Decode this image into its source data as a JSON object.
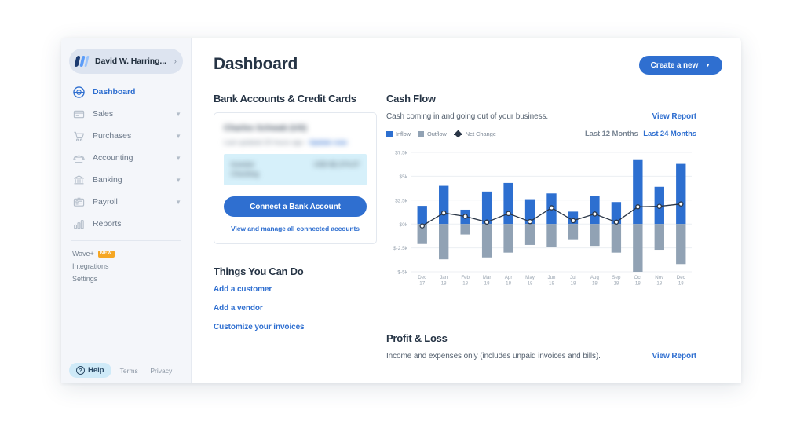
{
  "sidebar": {
    "profile": {
      "name": "David W. Harring...",
      "logo_icon": "wave-logo",
      "chevron_icon": "chevron-right-icon"
    },
    "items": [
      {
        "label": "Dashboard",
        "icon": "dashboard-icon",
        "active": true,
        "expandable": false
      },
      {
        "label": "Sales",
        "icon": "card-icon",
        "active": false,
        "expandable": true
      },
      {
        "label": "Purchases",
        "icon": "cart-icon",
        "active": false,
        "expandable": true
      },
      {
        "label": "Accounting",
        "icon": "scales-icon",
        "active": false,
        "expandable": true
      },
      {
        "label": "Banking",
        "icon": "bank-icon",
        "active": false,
        "expandable": true
      },
      {
        "label": "Payroll",
        "icon": "badge-icon",
        "active": false,
        "expandable": true
      },
      {
        "label": "Reports",
        "icon": "bar-chart-icon",
        "active": false,
        "expandable": false
      }
    ],
    "mini_items": [
      {
        "label": "Wave+",
        "badge": "NEW"
      },
      {
        "label": "Integrations",
        "badge": ""
      },
      {
        "label": "Settings",
        "badge": ""
      }
    ],
    "footer": {
      "help_label": "Help",
      "help_icon": "question-circle-icon",
      "terms_label": "Terms",
      "separator": "·",
      "privacy_label": "Privacy"
    }
  },
  "header": {
    "title": "Dashboard",
    "create_button": {
      "label": "Create a new",
      "caret_icon": "chevron-down-icon"
    }
  },
  "bank_section": {
    "heading": "Bank Accounts & Credit Cards",
    "card": {
      "institution": "Charles Schwab (US)",
      "status_prefix": "Last updated 20 hours ago · ",
      "status_action": "Update now",
      "status_icon": "refresh-icon",
      "account_name": "Investor Checking",
      "account_amount": "USD $2,374.07",
      "connect_button": "Connect a Bank Account",
      "manage_link": "View and manage all connected accounts"
    }
  },
  "things_section": {
    "heading": "Things You Can Do",
    "links": [
      "Add a customer",
      "Add a vendor",
      "Customize your invoices"
    ]
  },
  "cash_flow": {
    "heading": "Cash Flow",
    "subtitle": "Cash coming in and going out of your business.",
    "view_report": "View Report",
    "range_inactive": "Last 12 Months",
    "range_active": "Last 24 Months"
  },
  "profit_loss": {
    "heading": "Profit & Loss",
    "subtitle": "Income and expenses only (includes unpaid invoices and bills).",
    "view_report": "View Report"
  },
  "colors": {
    "inflow": "#2d6fd0",
    "outflow": "#91a2b4",
    "net_change": "#2a3647",
    "accent": "#2f6fd0",
    "sidebar_bg": "#f4f6fa",
    "text_dark": "#263445"
  },
  "chart_data": {
    "type": "bar",
    "title": "Cash Flow",
    "xlabel": "",
    "ylabel": "",
    "grid": true,
    "legend_position": "top-left",
    "ylim": [
      -5000,
      7500
    ],
    "ytick_labels": [
      "$7.5k",
      "$5k",
      "$2.5k",
      "$0k",
      "$-2.5k",
      "$-5k"
    ],
    "ytick_values": [
      7500,
      5000,
      2500,
      0,
      -2500,
      -5000
    ],
    "categories": [
      "Dec\n17",
      "Jan\n18",
      "Feb\n18",
      "Mar\n18",
      "Apr\n18",
      "May\n18",
      "Jun\n18",
      "Jul\n18",
      "Aug\n18",
      "Sep\n18",
      "Oct\n18",
      "Nov\n18",
      "Dec\n18"
    ],
    "series": [
      {
        "name": "Inflow",
        "color": "#2d6fd0",
        "values": [
          1900,
          4000,
          1500,
          3400,
          4300,
          2600,
          3200,
          1300,
          2900,
          2300,
          6700,
          3900,
          6300
        ]
      },
      {
        "name": "Outflow",
        "color": "#91a2b4",
        "values": [
          -2100,
          -3700,
          -1100,
          -3500,
          -3000,
          -2200,
          -2400,
          -1600,
          -2300,
          -3000,
          -5000,
          -2700,
          -4200
        ]
      },
      {
        "name": "Net Change",
        "color": "#2a3647",
        "type": "line",
        "values": [
          -200,
          1150,
          800,
          200,
          1100,
          250,
          1700,
          350,
          1050,
          200,
          1800,
          1850,
          2100
        ]
      }
    ]
  }
}
